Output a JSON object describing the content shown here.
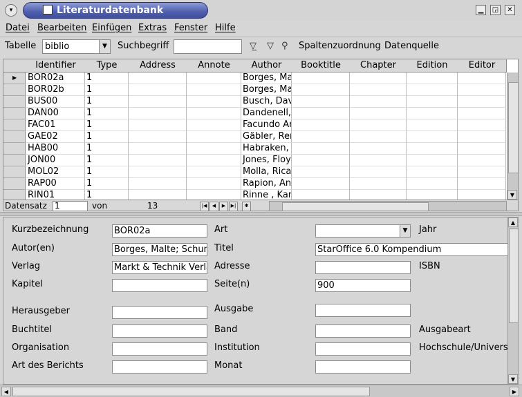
{
  "window": {
    "title": "Literaturdatenbank"
  },
  "menu": [
    "Datei",
    "Bearbeiten",
    "Einfügen",
    "Extras",
    "Fenster",
    "Hilfe"
  ],
  "toolbar": {
    "table_label": "Tabelle",
    "table_value": "biblio",
    "search_label": "Suchbegriff",
    "search_value": "",
    "column_assign": "Spaltenzuordnung",
    "data_source": "Datenquelle"
  },
  "grid": {
    "columns": [
      "Identifier",
      "Type",
      "Address",
      "Annote",
      "Author",
      "Booktitle",
      "Chapter",
      "Edition",
      "Editor"
    ],
    "rows": [
      [
        "BOR02a",
        "1",
        "",
        "",
        "Borges, Ma",
        "",
        "",
        "",
        ""
      ],
      [
        "BOR02b",
        "1",
        "",
        "",
        "Borges, Ma",
        "",
        "",
        "",
        ""
      ],
      [
        "BUS00",
        "1",
        "",
        "",
        "Busch, Dav",
        "",
        "",
        "",
        ""
      ],
      [
        "DAN00",
        "1",
        "",
        "",
        "Dandenell,",
        "",
        "",
        "",
        ""
      ],
      [
        "FAC01",
        "1",
        "",
        "",
        "Facundo Ar",
        "",
        "",
        "",
        ""
      ],
      [
        "GAE02",
        "1",
        "",
        "",
        "Gäbler, Rer",
        "",
        "",
        "",
        ""
      ],
      [
        "HAB00",
        "1",
        "",
        "",
        "Habraken, J",
        "",
        "",
        "",
        ""
      ],
      [
        "JON00",
        "1",
        "",
        "",
        "Jones, Floy",
        "",
        "",
        "",
        ""
      ],
      [
        "MOL02",
        "1",
        "",
        "",
        "Molla, Ricar",
        "",
        "",
        "",
        ""
      ],
      [
        "RAP00",
        "1",
        "",
        "",
        "Rapion, An",
        "",
        "",
        "",
        ""
      ],
      [
        "RIN01",
        "1",
        "",
        "",
        "Rinne , Kar",
        "",
        "",
        "",
        ""
      ]
    ],
    "nav": {
      "record_label": "Datensatz",
      "record_value": "1",
      "of_label": "von",
      "total": "13"
    }
  },
  "form": {
    "kurzbezeichnung": {
      "label": "Kurzbezeichnung",
      "value": "BOR02a"
    },
    "art": {
      "label": "Art",
      "value": ""
    },
    "jahr": {
      "label": "Jahr"
    },
    "autoren": {
      "label": "Autor(en)",
      "value": "Borges, Malte; Schum"
    },
    "titel": {
      "label": "Titel",
      "value": "StarOffice 6.0 Kompendium"
    },
    "verlag": {
      "label": "Verlag",
      "value": "Markt & Technik Verla"
    },
    "adresse": {
      "label": "Adresse",
      "value": ""
    },
    "isbn": {
      "label": "ISBN"
    },
    "kapitel": {
      "label": "Kapitel",
      "value": ""
    },
    "seiten": {
      "label": "Seite(n)",
      "value": "900"
    },
    "herausgeber": {
      "label": "Herausgeber",
      "value": ""
    },
    "ausgabe": {
      "label": "Ausgabe",
      "value": ""
    },
    "buchtitel": {
      "label": "Buchtitel",
      "value": ""
    },
    "band": {
      "label": "Band",
      "value": ""
    },
    "ausgabeart": {
      "label": "Ausgabeart"
    },
    "organisation": {
      "label": "Organisation",
      "value": ""
    },
    "institution": {
      "label": "Institution",
      "value": ""
    },
    "hochschule": {
      "label": "Hochschule/Universi"
    },
    "art_des_berichts": {
      "label": "Art des Berichts",
      "value": ""
    },
    "monat": {
      "label": "Monat",
      "value": ""
    }
  }
}
